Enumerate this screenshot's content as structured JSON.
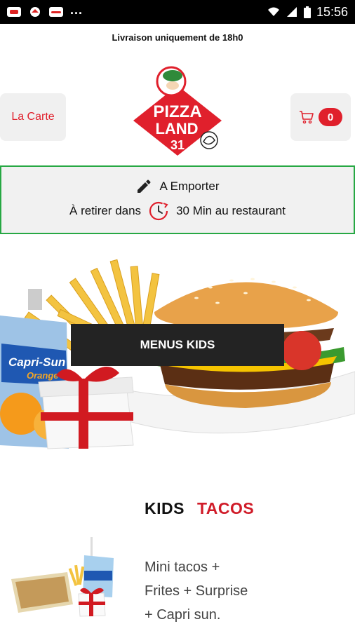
{
  "status_bar": {
    "time": "15:56",
    "overflow": "..."
  },
  "notice": "Livraison uniquement de 18h0",
  "nav": {
    "menu_label": "La Carte",
    "cart_count": "0"
  },
  "logo": {
    "line1": "PIZZA",
    "line2": "LAND",
    "line3": "31"
  },
  "order_mode": {
    "mode_label": "A Emporter",
    "pickup_prefix": "À retirer dans",
    "pickup_suffix": "30 Min au restaurant"
  },
  "hero": {
    "label": "MENUS KIDS",
    "juice_brand": "Capri-Sun",
    "juice_flavor": "Orange"
  },
  "product": {
    "title_part1": "KIDS",
    "title_part2": "TACOS",
    "desc_line1": "Mini tacos +",
    "desc_line2": "Frites + Surprise",
    "desc_line3": "+ Capri sun."
  },
  "colors": {
    "accent": "#e0202c",
    "border_green": "#27a844",
    "dark_label": "#232323"
  },
  "icons": [
    "wifi-icon",
    "signal-icon",
    "battery-icon",
    "cart-icon",
    "pencil-icon",
    "clock-icon"
  ]
}
